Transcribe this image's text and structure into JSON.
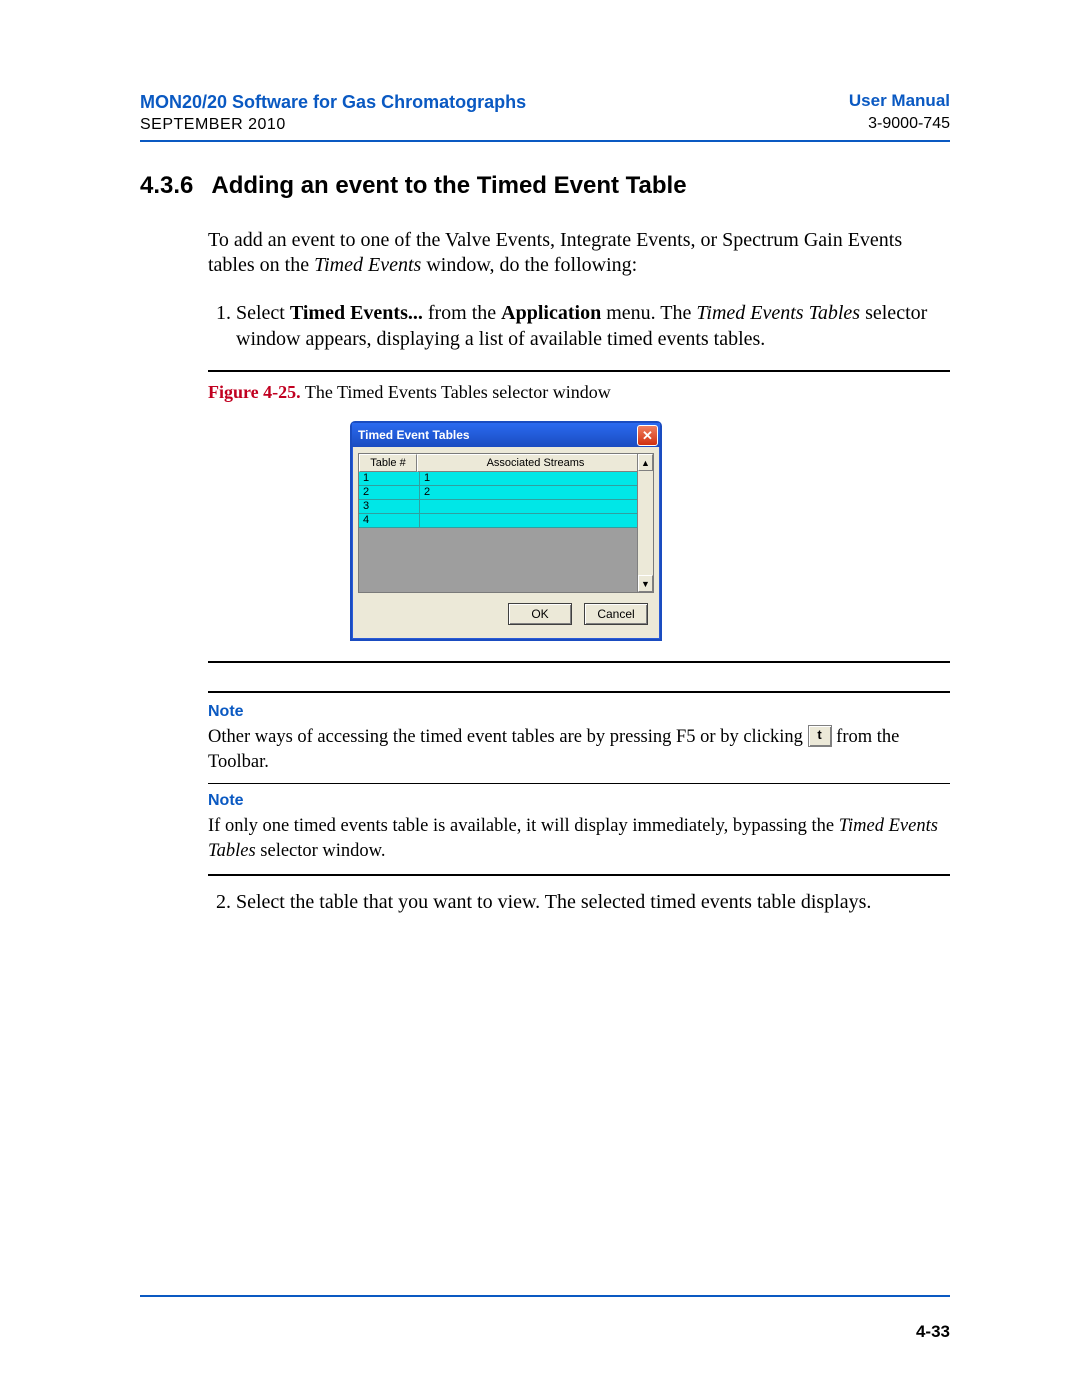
{
  "header": {
    "left_title": "MON20/20 Software for Gas Chromatographs",
    "left_date": "SEPTEMBER 2010",
    "right_title": "User Manual",
    "right_doc": "3-9000-745"
  },
  "section": {
    "number": "4.3.6",
    "title": "Adding an event to the Timed Event Table"
  },
  "intro": {
    "p1_a": "To add an event to one of the Valve Events, Integrate Events, or Spectrum Gain Events tables on the ",
    "p1_italic": "Timed Events",
    "p1_b": " window, do the following:"
  },
  "step1": {
    "a": "Select ",
    "bold1": "Timed Events...",
    "b": " from the ",
    "bold2": "Application",
    "c": " menu.  The ",
    "italic1": "Timed Events Tables",
    "d": " selector window appears, displaying a list of available timed events tables."
  },
  "figure": {
    "label": "Figure 4-25.",
    "caption": "  The Timed Events Tables selector window"
  },
  "window": {
    "title": "Timed Event Tables",
    "col1": "Table #",
    "col2": "Associated Streams",
    "rows": [
      {
        "n": "1",
        "s": "1"
      },
      {
        "n": "2",
        "s": "2"
      },
      {
        "n": "3",
        "s": ""
      },
      {
        "n": "4",
        "s": ""
      }
    ],
    "ok": "OK",
    "cancel": "Cancel",
    "close_glyph": "✕",
    "up_glyph": "▲",
    "down_glyph": "▼"
  },
  "note_label": "Note",
  "note1": {
    "a": "Other ways of accessing the timed event tables are by pressing F5 or by clicking ",
    "icon_glyph": "t",
    "b": " from the Toolbar."
  },
  "note2": {
    "a": "If only one timed events table is available, it will display immediately, bypassing the ",
    "italic": "Timed Events Tables",
    "b": " selector window."
  },
  "step2": "Select the table that you want to view.  The selected timed events table displays.",
  "page_number": "4-33"
}
